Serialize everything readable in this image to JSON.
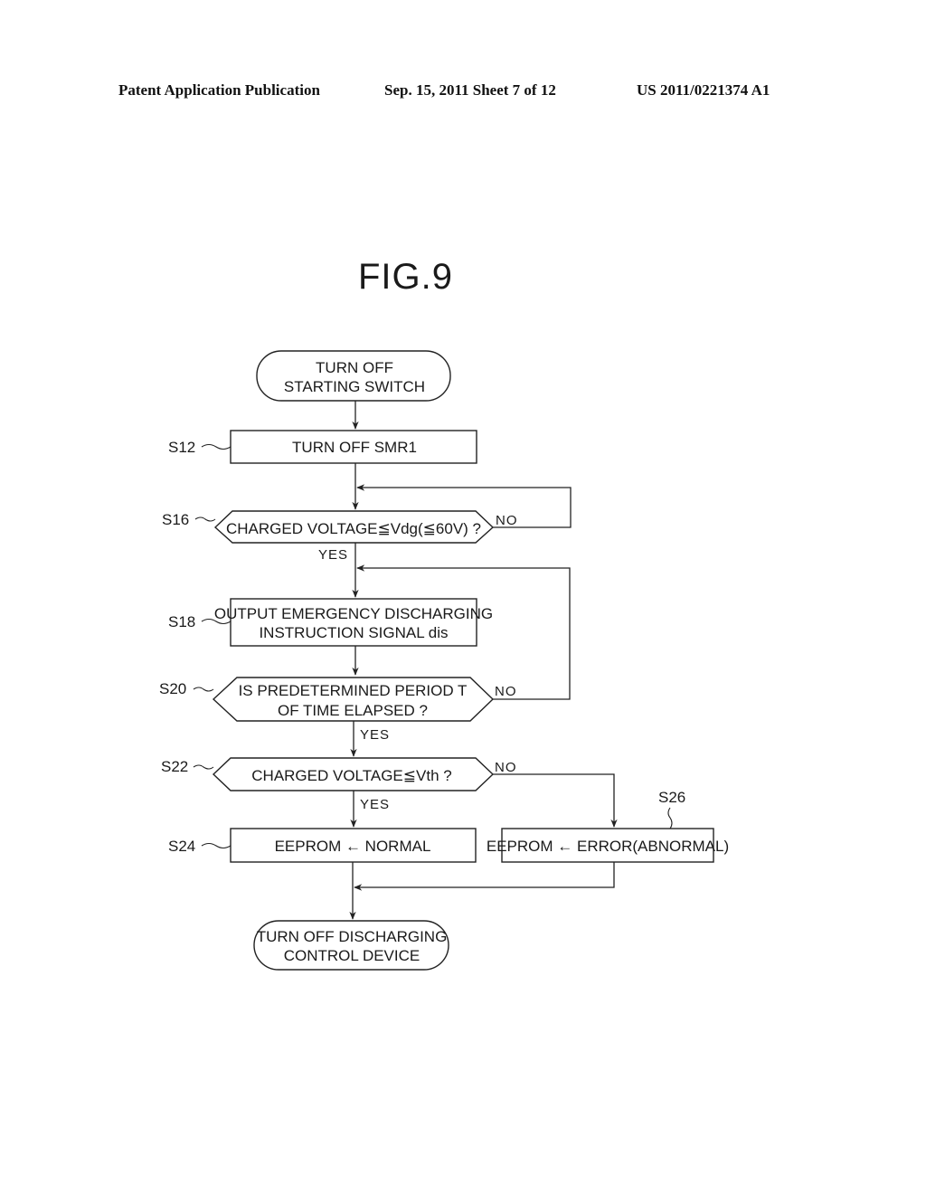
{
  "header": {
    "publication": "Patent Application Publication",
    "date_sheet": "Sep. 15, 2011   Sheet 7 of 12",
    "patent_number": "US 2011/0221374 A1"
  },
  "figure": {
    "title": "FIG.9"
  },
  "flowchart": {
    "start": {
      "lines": [
        "TURN OFF",
        "STARTING SWITCH"
      ]
    },
    "s12": {
      "step": "S12",
      "lines": [
        "TURN OFF SMR1"
      ]
    },
    "s16": {
      "step": "S16",
      "lines": [
        "CHARGED VOLTAGE≦Vdg(≦60V) ?"
      ],
      "yes": "YES",
      "no": "NO"
    },
    "s18": {
      "step": "S18",
      "lines": [
        "OUTPUT EMERGENCY DISCHARGING",
        "INSTRUCTION SIGNAL dis"
      ]
    },
    "s20": {
      "step": "S20",
      "lines": [
        "IS PREDETERMINED PERIOD T",
        "OF TIME ELAPSED ?"
      ],
      "yes": "YES",
      "no": "NO"
    },
    "s22": {
      "step": "S22",
      "lines": [
        "CHARGED VOLTAGE≦Vth ?"
      ],
      "yes": "YES",
      "no": "NO"
    },
    "s24": {
      "step": "S24",
      "lines": [
        "EEPROM ← NORMAL"
      ]
    },
    "s26": {
      "step": "S26",
      "lines": [
        "EEPROM ← ERROR(ABNORMAL)"
      ]
    },
    "end": {
      "lines": [
        "TURN OFF DISCHARGING",
        "CONTROL DEVICE"
      ]
    }
  }
}
